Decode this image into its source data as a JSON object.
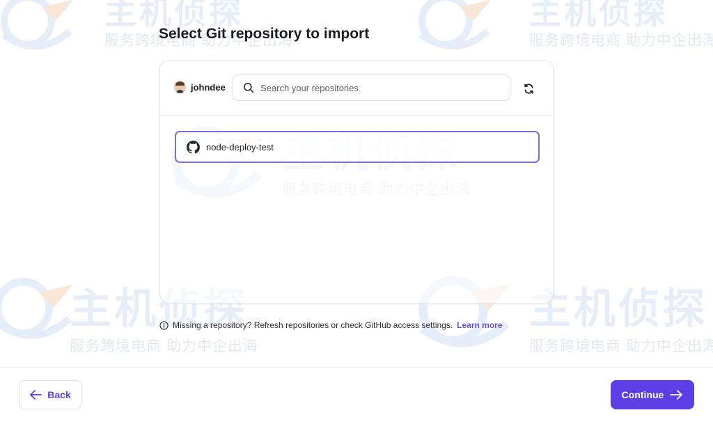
{
  "page": {
    "title": "Select Git repository to import"
  },
  "account": {
    "name": "johndee",
    "avatar_icon": "user-avatar"
  },
  "search": {
    "placeholder": "Search your repositories",
    "value": ""
  },
  "toolbar": {
    "refresh_icon": "refresh-icon"
  },
  "repositories": [
    {
      "name": "node-deploy-test",
      "icon": "github-icon",
      "selected": true
    }
  ],
  "hint": {
    "text": "Missing a repository? Refresh repositories or check GitHub access settings.",
    "link_label": "Learn more"
  },
  "footer": {
    "back_label": "Back",
    "continue_label": "Continue"
  },
  "watermark": {
    "brand": "主机侦探",
    "slogan": "服务跨境电商 助力中企出海"
  },
  "colors": {
    "accent": "#5b3ee6",
    "selected_border": "#7b6ce0",
    "link": "#6b4fe3",
    "watermark": "#cfe0f3"
  }
}
